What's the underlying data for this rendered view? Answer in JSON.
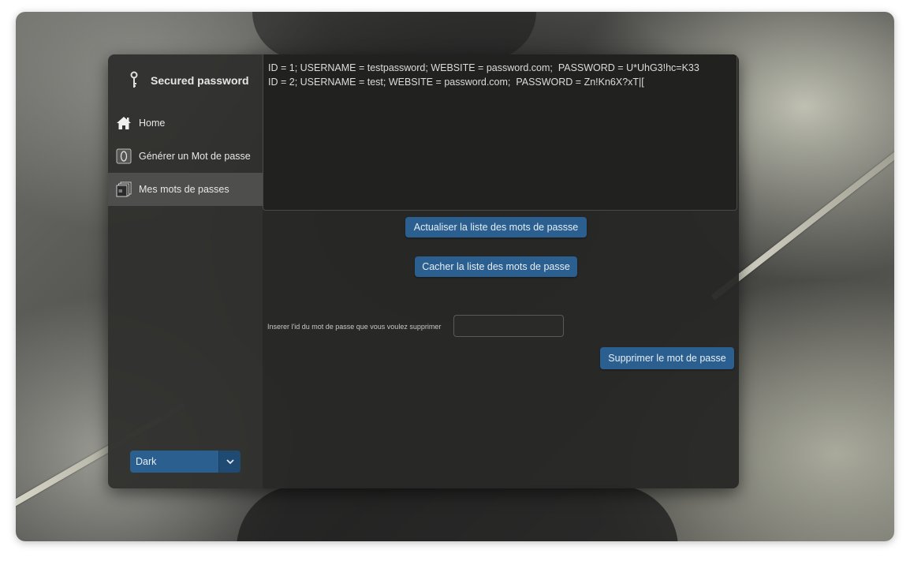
{
  "app": {
    "title": "Secured password"
  },
  "sidebar": {
    "items": [
      {
        "label": "Home",
        "icon": "home-icon"
      },
      {
        "label": "Générer un Mot de passe",
        "icon": "generate-icon"
      },
      {
        "label": "Mes mots de passes",
        "icon": "documents-icon",
        "active": true
      }
    ],
    "theme_select": {
      "value": "Dark",
      "icon": "chevron-down-icon"
    }
  },
  "main": {
    "password_list": [
      "ID = 1; USERNAME = testpassword; WEBSITE = password.com;  PASSWORD = U*UhG3!hc=K33",
      "ID = 2; USERNAME = test; WEBSITE = password.com;  PASSWORD = Zn!Kn6X?xT|["
    ],
    "refresh_button": "Actualiser la liste des mots de passse",
    "hide_button": "Cacher la liste des mots de passe",
    "delete_label": "Inserer l'id du mot de passe que vous voulez supprimer",
    "delete_input_value": "",
    "delete_button": "Supprimer le mot de passe"
  },
  "colors": {
    "accent": "#2b5f8f",
    "sidebar_bg": "#30302e",
    "main_bg": "#282827"
  }
}
